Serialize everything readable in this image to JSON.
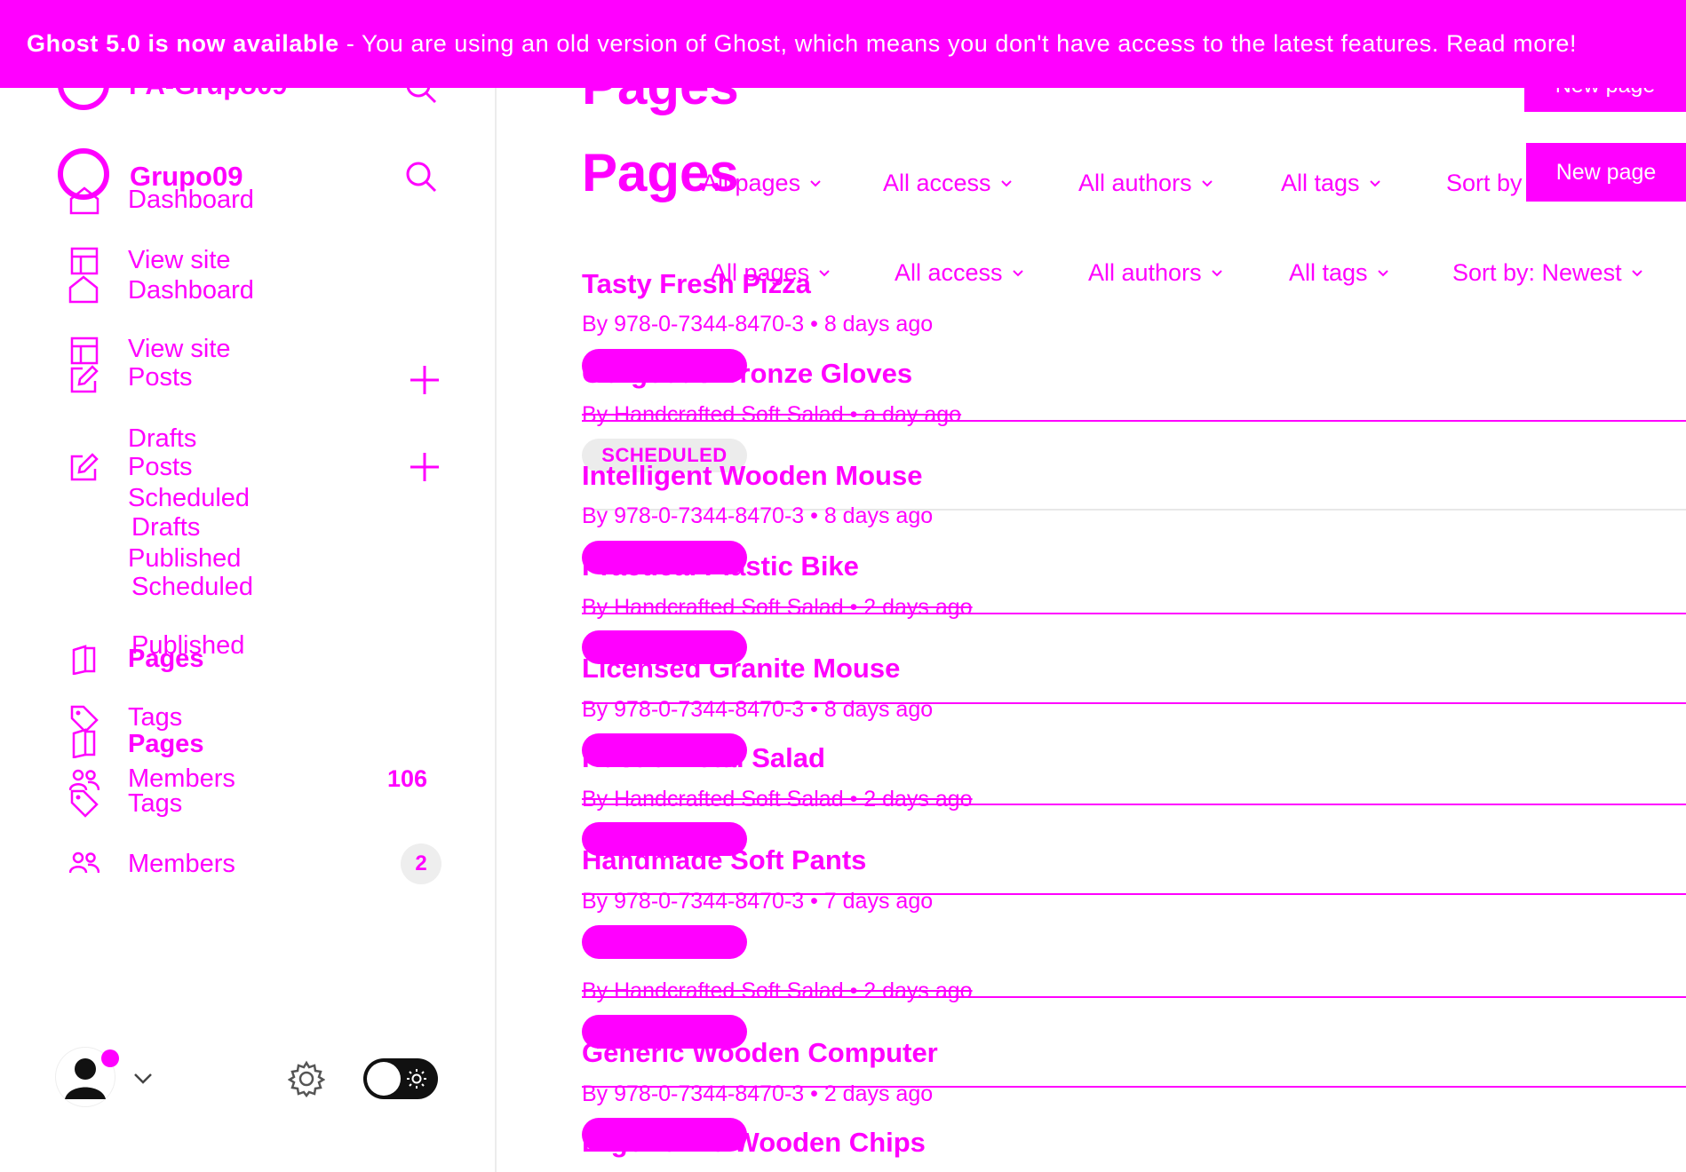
{
  "banner": {
    "bold": "Ghost 5.0 is now available",
    "text": " - You are using an old version of Ghost, which means you don't have access to the latest features. Read more!"
  },
  "sidebar": {
    "brand_ghost": "PA-Grupo09",
    "brand": "Grupo09",
    "ghost_items": {
      "dashboard": "Dashboard",
      "view_site": "View site",
      "posts": "Posts",
      "drafts": "Drafts",
      "scheduled": "Scheduled",
      "published": "Published",
      "pages": "Pages",
      "tags": "Tags",
      "members": "Members",
      "members_count": "106"
    },
    "items": {
      "dashboard": "Dashboard",
      "view_site": "View site",
      "posts": "Posts",
      "drafts": "Drafts",
      "scheduled": "Scheduled",
      "published": "Published",
      "pages": "Pages",
      "tags": "Tags",
      "members": "Members",
      "members_count": "2"
    }
  },
  "header": {
    "title_ghost": "Pages",
    "title": "Pages",
    "new_page_ghost": "New page",
    "new_page": "New page"
  },
  "filters_ghost": {
    "type": "All pages",
    "access": "All access",
    "authors": "All authors",
    "tags": "All tags",
    "sort": "Sort by"
  },
  "filters": {
    "type": "All pages",
    "access": "All access",
    "authors": "All authors",
    "tags": "All tags",
    "sort": "Sort by: Newest"
  },
  "rows": [
    {
      "title": "Tasty Fresh Pizza",
      "meta": "By 978-0-7344-8470-3 • 8 days ago"
    },
    {
      "title": "Gorgeous Bronze Gloves",
      "meta": "By Handcrafted Soft Salad • a day ago"
    },
    {
      "title": "Intelligent Wooden Mouse",
      "meta": "By 978-0-7344-8470-3 • 8 days ago",
      "status": "SCHEDULED"
    },
    {
      "title": "Practical Plastic Bike",
      "meta": "By Handcrafted Soft Salad • 2 days ago"
    },
    {
      "title": "Licensed Granite Mouse",
      "meta": "By 978-0-7344-8470-3 • 8 days ago"
    },
    {
      "title": "Rustic Metal Salad",
      "meta": "By Handcrafted Soft Salad • 2 days ago"
    },
    {
      "title": "Handmade Soft Pants",
      "meta": "By 978-0-7344-8470-3 • 7 days ago"
    },
    {
      "title": "",
      "meta": "By Handcrafted Soft Salad • 2 days ago"
    },
    {
      "title": "Generic Wooden Computer",
      "meta": "By 978-0-7344-8470-3 • 2 days ago"
    },
    {
      "title": "Ergonomic Wooden Chips",
      "meta": ""
    }
  ]
}
